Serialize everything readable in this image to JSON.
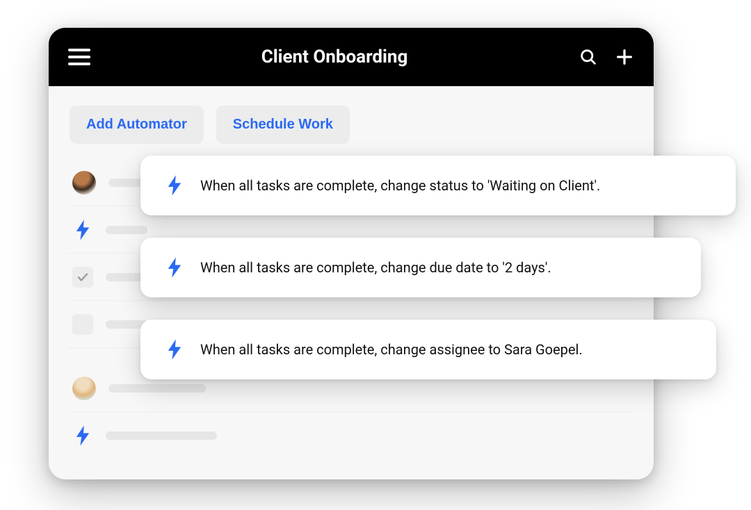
{
  "header": {
    "title": "Client Onboarding"
  },
  "toolbar": {
    "add_automator_label": "Add Automator",
    "schedule_work_label": "Schedule Work"
  },
  "automations": {
    "card1": "When all tasks are complete, change status to 'Waiting on Client'.",
    "card2": "When all tasks are complete, change due date to '2 days'.",
    "card3": "When all tasks are complete, change assignee to Sara Goepel."
  },
  "icons": {
    "menu": "hamburger-icon",
    "search": "search-icon",
    "add": "plus-icon",
    "bolt": "bolt-icon",
    "check": "check-icon",
    "avatar1": "avatar-person-1",
    "avatar2": "avatar-person-2"
  },
  "colors": {
    "accent": "#2a6af2",
    "header_bg": "#000000",
    "surface": "#f7f7f8"
  }
}
